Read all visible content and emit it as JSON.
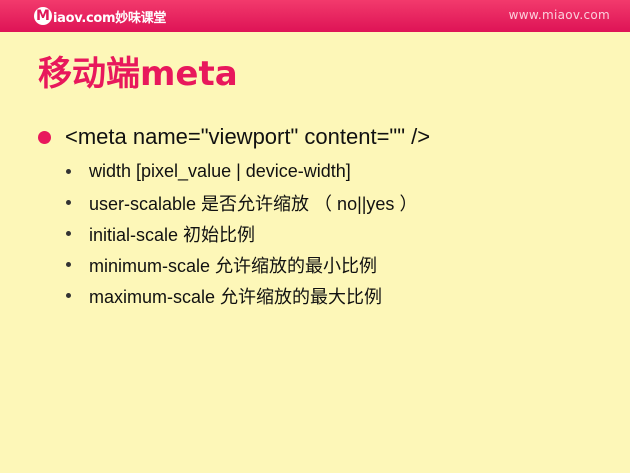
{
  "header": {
    "logo_initial": "M",
    "logo_text": "iaov.com妙味课堂",
    "site_url": "www.miaov.com"
  },
  "slide": {
    "title": "移动端meta",
    "main_bullet": "<meta name=\"viewport\" content=\"\" />",
    "sub_bullets": [
      "width [pixel_value | device-width]",
      "user-scalable 是否允许缩放 （ no||yes ）",
      "initial-scale 初始比例",
      "minimum-scale 允许缩放的最小比例",
      "maximum-scale 允许缩放的最大比例"
    ]
  },
  "colors": {
    "header_bg": "#e0185a",
    "background": "#fdf7b8",
    "accent": "#e8185c",
    "text": "#111111"
  }
}
